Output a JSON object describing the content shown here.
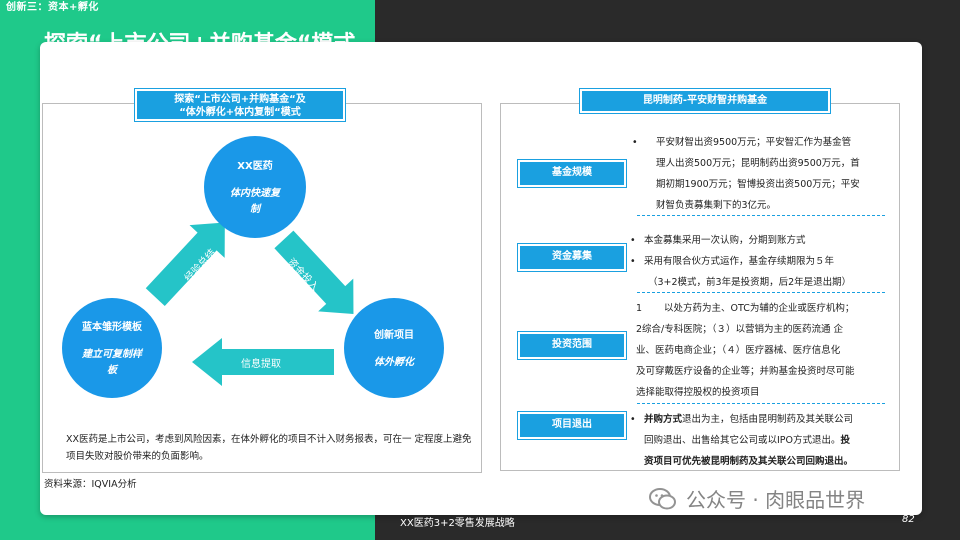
{
  "header": {
    "section_tag": "创新三：资本+孵化",
    "title": "探索“上市公司+并购基金“模式"
  },
  "left": {
    "header": [
      "探索“上市公司+并购基金“及",
      "“体外孵化+体内复制“模式"
    ],
    "circles": {
      "top": {
        "title": "XX医药",
        "subtitle": [
          "体内快速复",
          "制"
        ]
      },
      "left": {
        "title": "蓝本雏形模板",
        "subtitle": [
          "建立可复制样",
          "板"
        ]
      },
      "right": {
        "title": "创新项目",
        "subtitle": [
          "体外孵化"
        ]
      }
    },
    "arrows": {
      "experience": "经验总结",
      "capital": "资金投入",
      "info": "信息提取"
    },
    "description": "XX医药是上市公司，考虑到风险因素，在体外孵化的项目不计入财务报表，可在一 定程度上避免项目失败对股价带来的负面影响。",
    "source": "资料来源：IQVIA分析"
  },
  "right": {
    "header": "昆明制药-平安财智并购基金",
    "rows": [
      {
        "tag": "基金规模",
        "items": [
          {
            "bullet": "•",
            "text": [
              "平安财智出资9500万元；平安智汇作为基金管",
              "理人出资500万元；昆明制药出资9500万元，首",
              "期初期1900万元；智博投资出资500万元；平安",
              "财智负责募集剩下的3亿元。"
            ]
          }
        ]
      },
      {
        "tag": "资金募集",
        "items": [
          {
            "bullet": "•",
            "text": [
              "本金募集采用一次认购，分期到账方式"
            ]
          },
          {
            "bullet": "•",
            "text": [
              "采用有限合伙方式运作，基金存续期限为５年",
              "（3+2模式，前3年是投资期，后2年是退出期）"
            ]
          }
        ]
      },
      {
        "tag": "投资范围",
        "items": [
          {
            "bullet": "1",
            "text": [
              "以处方药为主、OTC为辅的企业或医疗机构；",
              "2综合/专科医院；（３）以营销为主的医药流通 企",
              "业、医药电商企业；（４）医疗器械、医疗信息化",
              "及可穿戴医疗设备的企业等；并购基金投资时尽可能",
              "选择能取得控股权的投资项目"
            ]
          }
        ]
      },
      {
        "tag": "项目退出",
        "items": [
          {
            "bullet": "•",
            "lead_bold": "并购方式",
            "text": [
              "退出为主，包括由昆明制药及其关联公司",
              "回购退出、出售给其它公司或以IPO方式退出。",
              "项目可优先被昆明制药及其关联公司回购退出。"
            ],
            "bold_prefix_line3": "投",
            "bold_line3": "资项目可优先被昆明制药及其关联公司回购退出。"
          }
        ]
      }
    ]
  },
  "footer": {
    "label": "XX医药3+2零售发展战略",
    "page": "82"
  },
  "watermark": {
    "text": "公众号 · 肉眼品世界"
  },
  "colors": {
    "green": "#1fc98a",
    "dark": "#2a2a2a",
    "blue": "#1aa0e0",
    "circle": "#1a98e8",
    "arrow": "#25c4c8"
  }
}
